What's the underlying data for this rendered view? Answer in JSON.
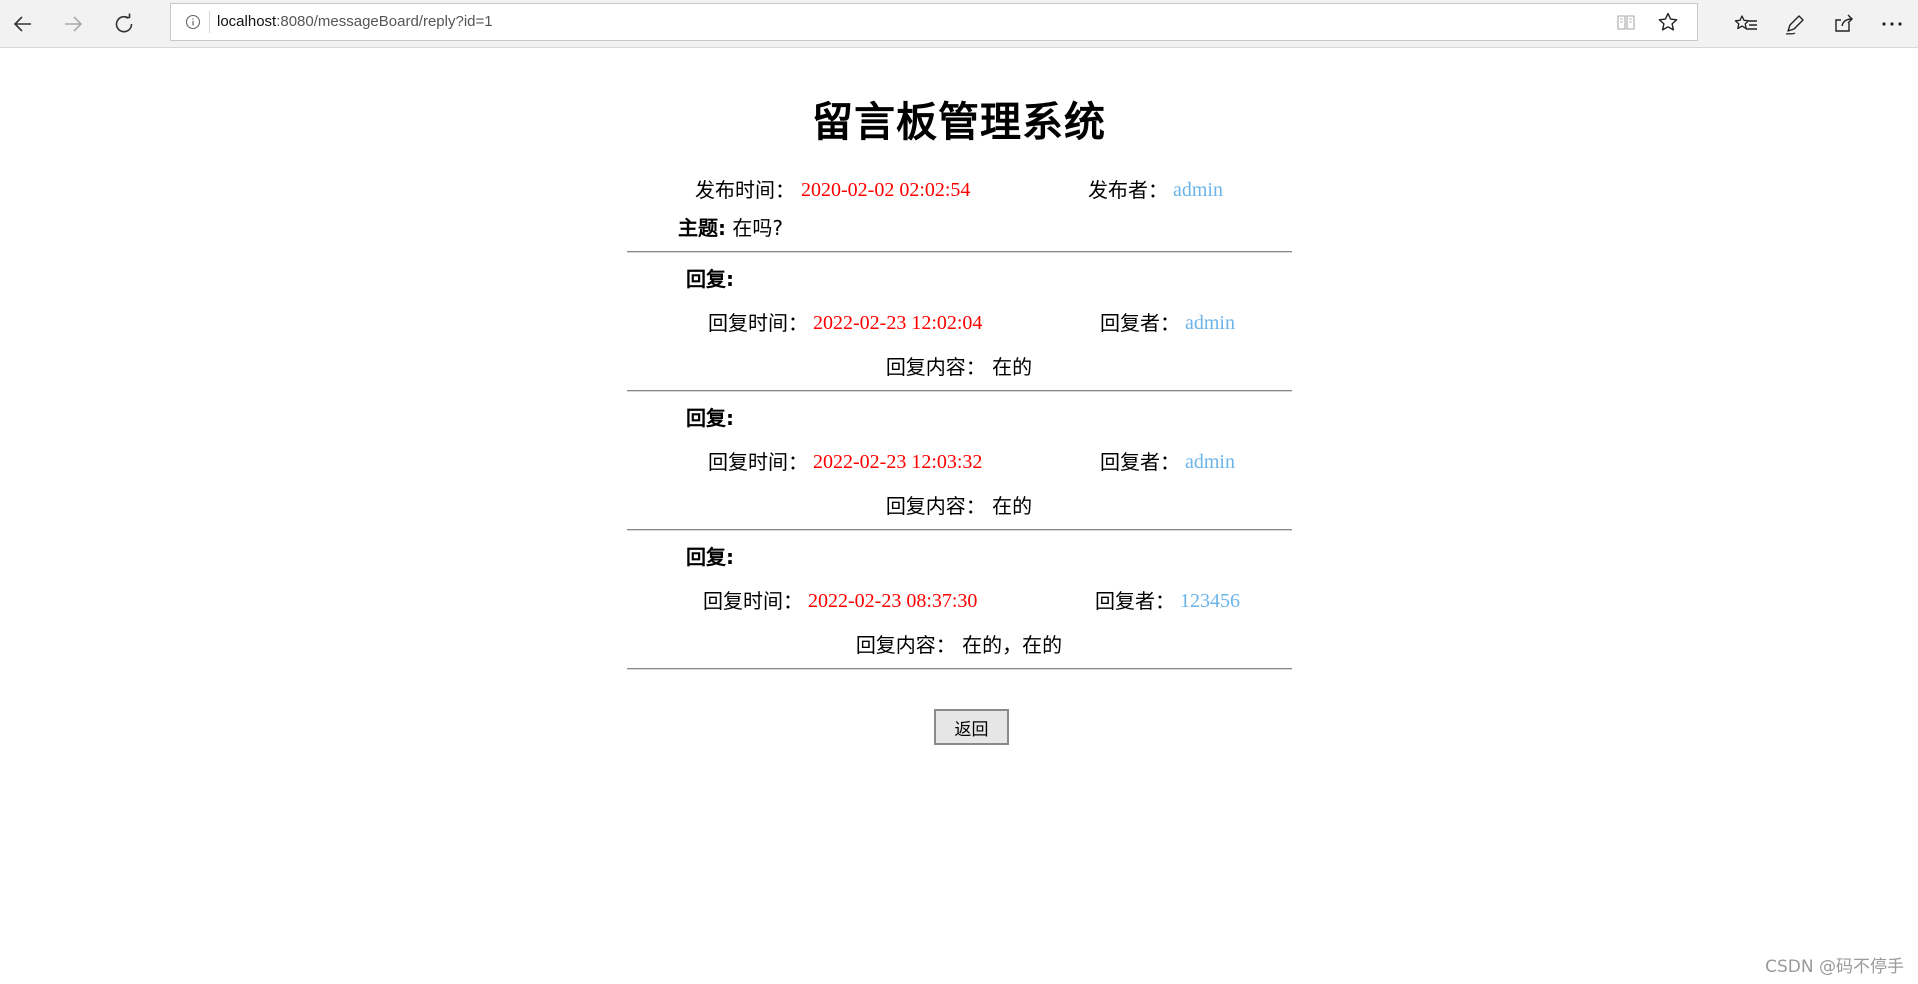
{
  "browser": {
    "url_host": "localhost",
    "url_rest": ":8080/messageBoard/reply?id=1",
    "icons": {
      "back": "back-arrow-icon",
      "forward": "forward-arrow-icon",
      "refresh": "refresh-icon",
      "info": "info-icon",
      "reading_view": "reading-view-icon",
      "favorite": "star-icon",
      "favorites_bar": "favorites-list-icon",
      "notes": "pen-icon",
      "share": "share-icon",
      "more": "more-icon"
    }
  },
  "page": {
    "title": "留言板管理系统",
    "post": {
      "time_label": "发布时间：",
      "time": "2020-02-02 02:02:54",
      "author_label": "发布者：",
      "author": "admin",
      "subject_label": "主题:",
      "subject": "在吗?"
    },
    "replies": [
      {
        "header": "回复:",
        "time_label": "回复时间：",
        "time": "2022-02-23 12:02:04",
        "author_label": "回复者：",
        "author": "admin",
        "content_label": "回复内容：",
        "content": "在的"
      },
      {
        "header": "回复:",
        "time_label": "回复时间：",
        "time": "2022-02-23 12:03:32",
        "author_label": "回复者：",
        "author": "admin",
        "content_label": "回复内容：",
        "content": "在的"
      },
      {
        "header": "回复:",
        "time_label": "回复时间：",
        "time": "2022-02-23 08:37:30",
        "author_label": "回复者：",
        "author": "123456",
        "content_label": "回复内容：",
        "content": "在的，在的"
      }
    ],
    "back_button": "返回"
  },
  "watermark": "CSDN @码不停手",
  "colors": {
    "time": "#ff0000",
    "author": "#6bb4ea"
  }
}
